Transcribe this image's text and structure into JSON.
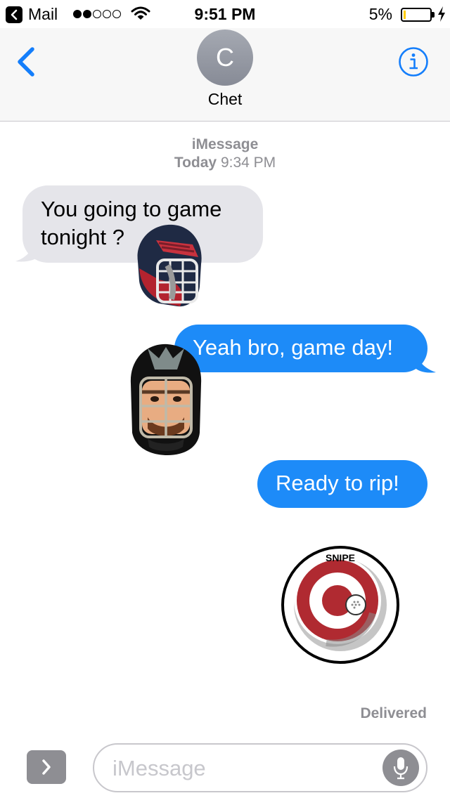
{
  "status_bar": {
    "back_app": "Mail",
    "time": "9:51 PM",
    "battery": "5%"
  },
  "header": {
    "avatar_initial": "C",
    "contact_name": "Chet"
  },
  "thread": {
    "service": "iMessage",
    "day": "Today",
    "time": "9:34 PM"
  },
  "messages": [
    {
      "direction": "received",
      "text": "You going to game tonight ?"
    },
    {
      "direction": "sent",
      "text": "Yeah bro, game day!"
    },
    {
      "direction": "sent",
      "text": "Ready to rip!"
    }
  ],
  "stickers": {
    "target_text": "SNIPE"
  },
  "status": "Delivered",
  "composer": {
    "placeholder": "iMessage"
  },
  "colors": {
    "sent_bubble": "#1d8bf8",
    "received_bubble": "#e5e5ea",
    "accent": "#147efb"
  },
  "icons": [
    "back-app-icon",
    "wifi-icon",
    "battery-icon",
    "charging-icon",
    "back-chevron-icon",
    "info-icon",
    "apps-chevron-icon",
    "microphone-icon"
  ]
}
